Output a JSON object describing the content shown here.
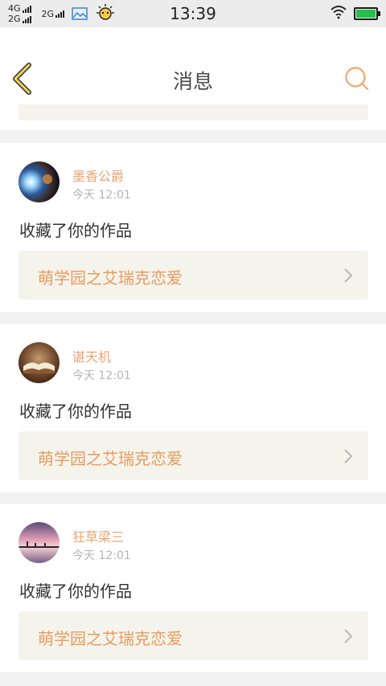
{
  "status_bar": {
    "net1_top": "4G",
    "net1_bottom": "2G",
    "net2": "2G",
    "time": "13:39",
    "icons": [
      "signal-bars-icon",
      "image-notification-icon",
      "bulb-notification-icon",
      "wifi-icon",
      "battery-icon"
    ],
    "battery_color": "#23c04a"
  },
  "header": {
    "title": "消息",
    "back_icon": "chevron-left-icon",
    "search_icon": "search-icon",
    "accent": "#f5a66c"
  },
  "messages": [
    {
      "username": "墨香公爵",
      "time": "今天 12:01",
      "action": "收藏了你的作品",
      "work_title": "萌学园之艾瑞克恋爱",
      "avatar": "avatar-light-burst"
    },
    {
      "username": "谌天机",
      "time": "今天 12:01",
      "action": "收藏了你的作品",
      "work_title": "萌学园之艾瑞克恋爱",
      "avatar": "avatar-open-book"
    },
    {
      "username": "狂草梁三",
      "time": "今天 12:01",
      "action": "收藏了你的作品",
      "work_title": "萌学园之艾瑞克恋爱",
      "avatar": "avatar-sunset-pier"
    }
  ],
  "colors": {
    "username": "#e8a472",
    "work_title": "#ea9a5e",
    "work_box_bg": "#f4f4ec",
    "page_bg": "#f2f2f2"
  }
}
